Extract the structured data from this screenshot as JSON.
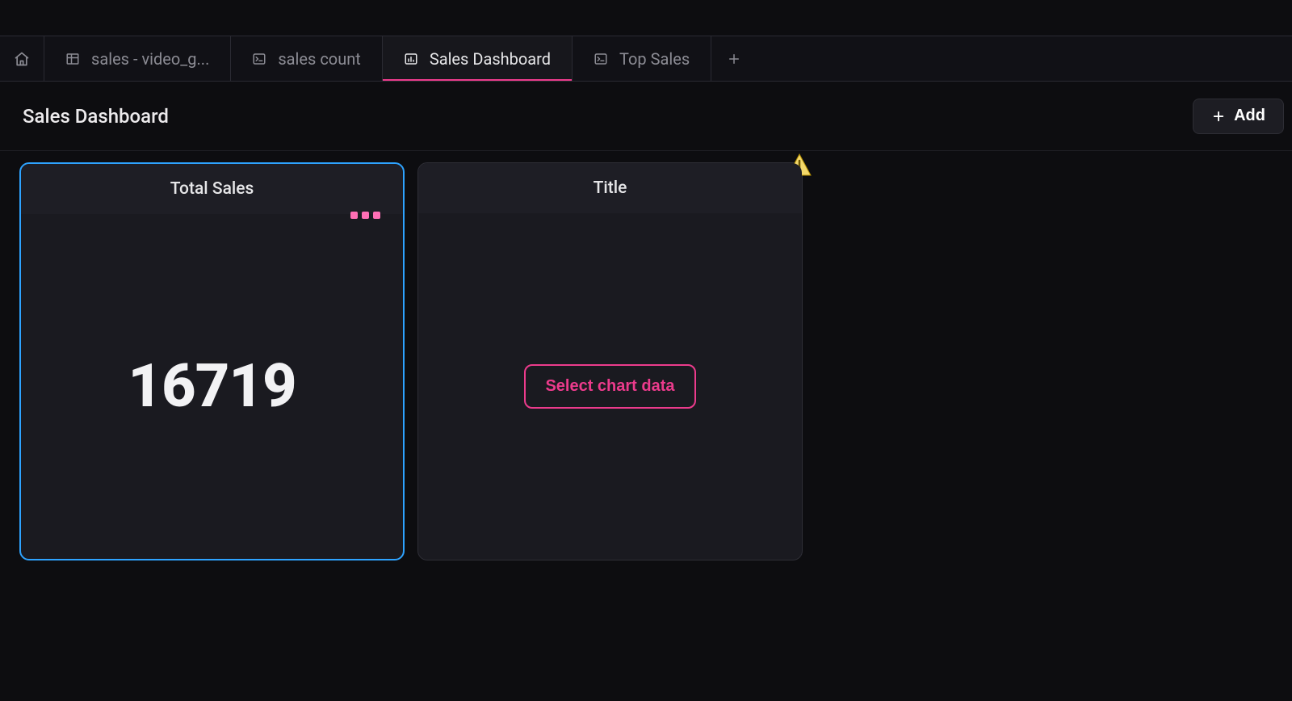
{
  "tabs": [
    {
      "label": "sales - video_g...",
      "icon": "table"
    },
    {
      "label": "sales count",
      "icon": "terminal"
    },
    {
      "label": "Sales Dashboard",
      "icon": "chart",
      "active": true
    },
    {
      "label": "Top Sales",
      "icon": "terminal"
    }
  ],
  "header": {
    "title": "Sales Dashboard",
    "add_label": "Add"
  },
  "cards": {
    "total_sales": {
      "title": "Total Sales",
      "value": "16719"
    },
    "empty": {
      "title": "Title",
      "button": "Select chart data"
    }
  }
}
